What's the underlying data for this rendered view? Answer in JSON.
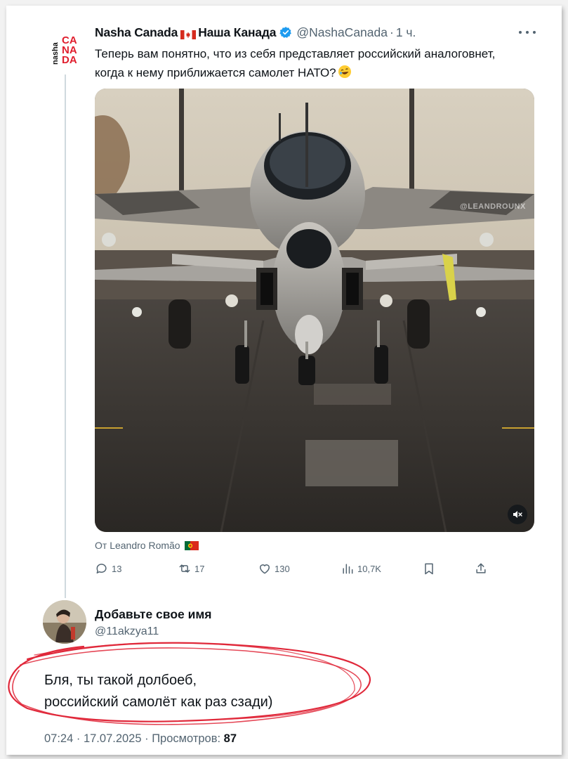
{
  "tweet": {
    "display_name": "Nasha Canada",
    "display_name_ru": "Наша Канада",
    "handle": "@NashaCanada",
    "separator": "·",
    "time": "1 ч.",
    "text": "Теперь вам понятно, что из себя представляет российский аналоговнет, когда к нему приближается самолет НАТО?",
    "avatar_logo_text": "nasha CANADA",
    "media_watermark": "@LEANDROUNX",
    "attribution": "От Leandro Romão",
    "counts": {
      "replies": "13",
      "reposts": "17",
      "likes": "130",
      "views": "10,7K"
    },
    "icons": {
      "verified": "verified-badge-icon",
      "more": "more-dots-icon",
      "reply": "reply-bubble-icon",
      "repost": "repost-arrows-icon",
      "like": "heart-icon",
      "views": "bar-chart-icon",
      "bookmark": "bookmark-icon",
      "share": "share-upload-icon",
      "mute": "muted-speaker-icon"
    },
    "colors": {
      "accent": "#1d9bf0",
      "secondary_text": "#536471",
      "primary_text": "#0f1419"
    }
  },
  "reply": {
    "display_name": "Добавьте свое имя",
    "handle": "@11akzya11",
    "line1": "Бля, ты такой долбоеб,",
    "line2": "российский самолёт как раз сзади)",
    "timestamp": "07:24 · 17.07.2025 · Просмотров:",
    "views": "87",
    "scribble_color": "#e0283a"
  }
}
